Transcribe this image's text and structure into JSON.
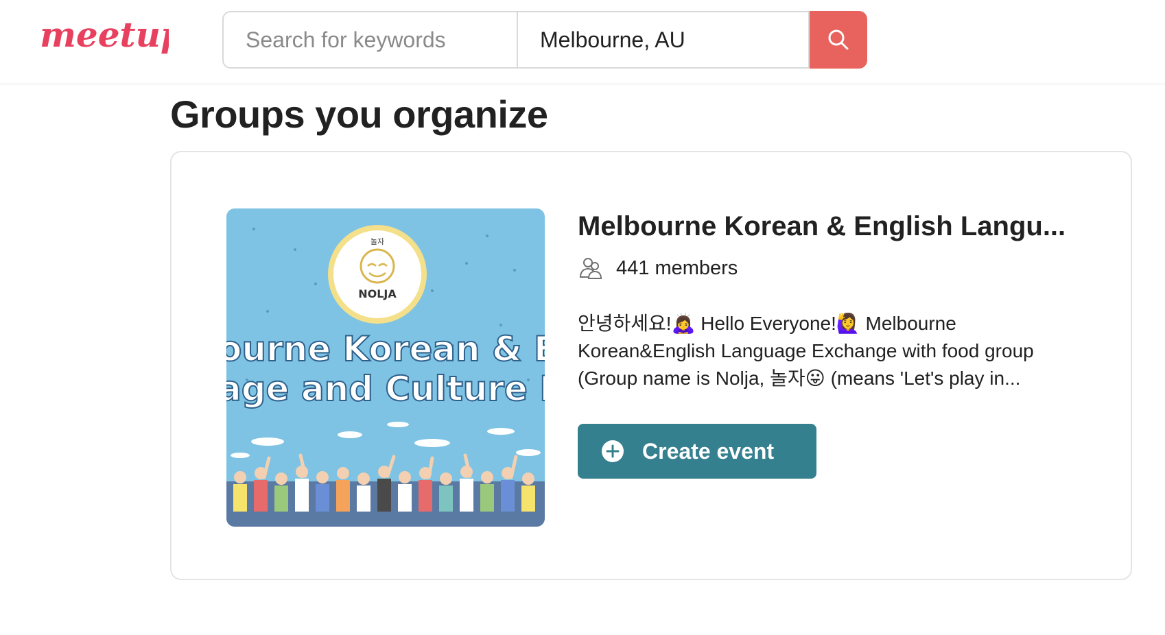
{
  "brand": {
    "name": "meetup",
    "color": "#e8415f"
  },
  "search": {
    "keyword_placeholder": "Search for keywords",
    "keyword_value": "",
    "location_value": "Melbourne, AU",
    "button_icon": "search-icon",
    "button_color": "#e8635d"
  },
  "page": {
    "title": "Groups you organize"
  },
  "group": {
    "name": "Melbourne Korean & English Langu...",
    "members": "441 members",
    "description": "안녕하세요!🙇‍♀️ Hello Everyone!🙋‍♀️ Melbourne Korean&English Language Exchange with food group (Group name is Nolja, 놀자😛 (means 'Let's play in...",
    "image": {
      "badge_small": "놀자",
      "badge_name": "NOLJA",
      "banner_line1": "ourne Korean & En",
      "banner_line2": "age and Culture Exc"
    },
    "create_label": "Create event",
    "button_color": "#35808f"
  }
}
